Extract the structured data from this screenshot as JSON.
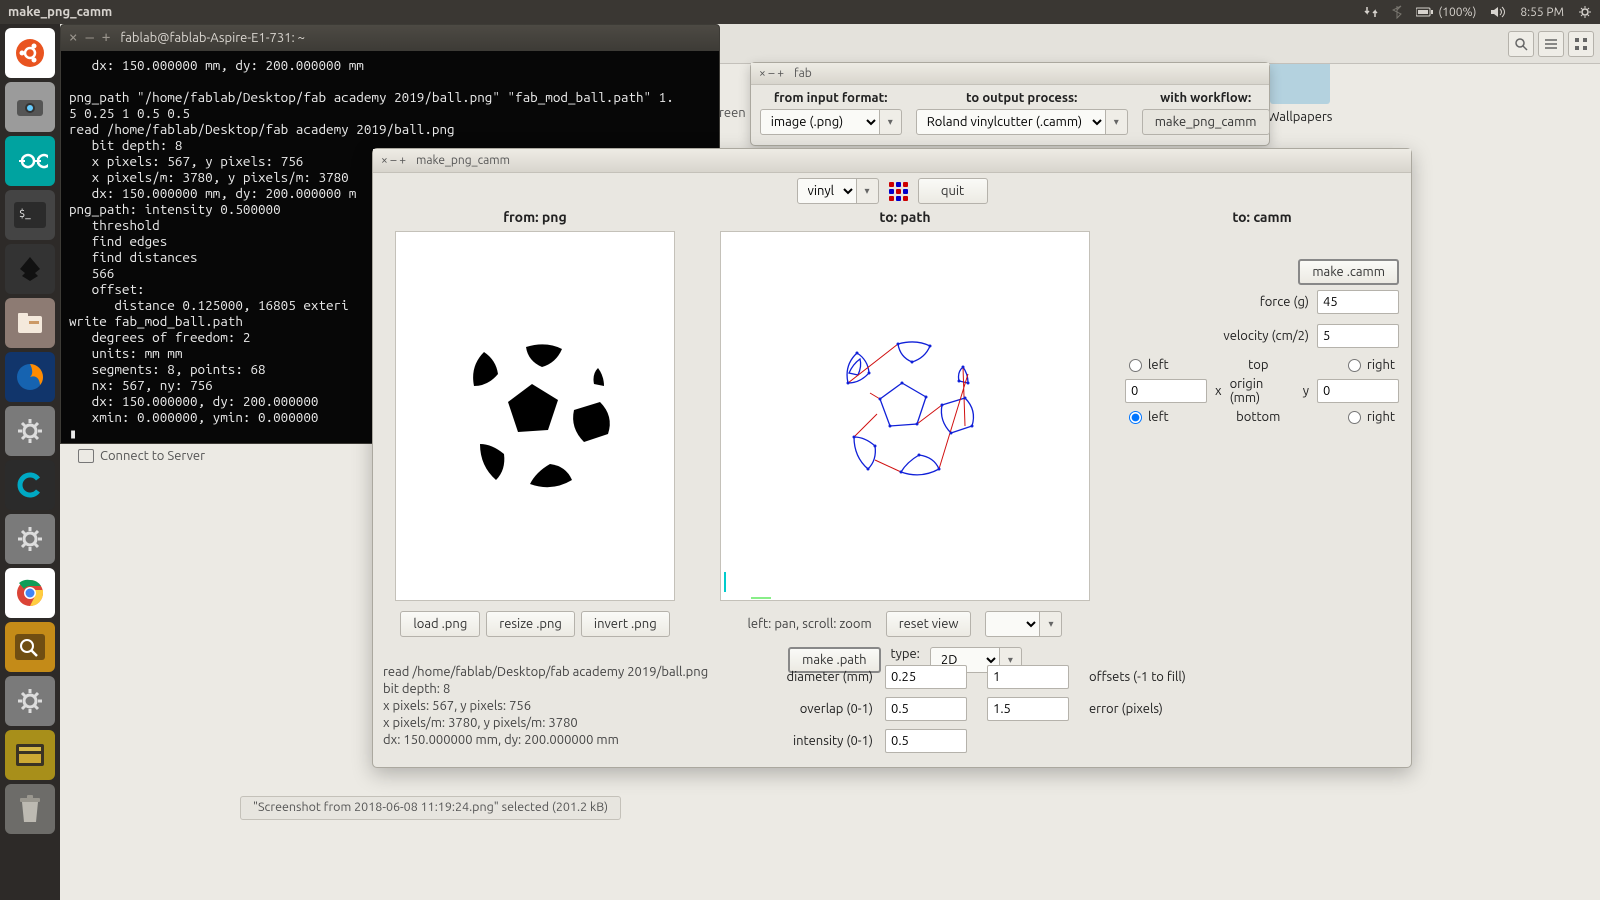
{
  "menubar": {
    "app_title": "make_png_camm",
    "battery": "(100%)",
    "time": "8:55 PM"
  },
  "desktop": {
    "folder_label": "Wallpapers"
  },
  "nautilus_status": "\"Screenshot from 2018-06-08 11:19:24.png\" selected  (201.2 kB)",
  "connect_to_server": "Connect to Server",
  "terminal": {
    "title": "fablab@fablab-Aspire-E1-731: ~",
    "text": "   dx: 150.000000 mm, dy: 200.000000 mm\n\npng_path \"/home/fablab/Desktop/fab academy 2019/ball.png\" \"fab_mod_ball.path\" 1.\n5 0.25 1 0.5 0.5\nread /home/fablab/Desktop/fab academy 2019/ball.png\n   bit depth: 8\n   x pixels: 567, y pixels: 756\n   x pixels/m: 3780, y pixels/m: 3780\n   dx: 150.000000 mm, dy: 200.000000 m\npng_path: intensity 0.500000\n   threshold\n   find edges\n   find distances\n   566\n   offset:\n      distance 0.125000, 16805 exteri\nwrite fab_mod_ball.path\n   degrees of freedom: 2\n   units: mm mm\n   segments: 8, points: 68\n   nx: 567, ny: 756\n   dx: 150.000000, dy: 200.000000\n   xmin: 0.000000, ymin: 0.000000\n▮"
  },
  "fab": {
    "title": "fab",
    "from_label": "from input format:",
    "to_label": "to output process:",
    "wf_label": "with workflow:",
    "from_value": "image (.png)",
    "to_value": "Roland vinylcutter (.camm)",
    "wf_value": "make_png_camm",
    "screen_frag": "reen"
  },
  "mpc": {
    "title": "make_png_camm",
    "vinyl": "vinyl",
    "quit": "quit",
    "hdr_from": "from: png",
    "hdr_path": "to: path",
    "hdr_camm": "to: camm",
    "load": "load .png",
    "resize": "resize .png",
    "invert": "invert .png",
    "pan_hint": "left: pan, scroll: zoom",
    "reset_view": "reset view",
    "make_path": "make .path",
    "type_lbl": "type:",
    "type_val": "2D",
    "diam_lbl": "diameter (mm)",
    "diam_val": "0.25",
    "offsets_val": "1",
    "offsets_lbl": "offsets (-1 to fill)",
    "overlap_lbl": "overlap (0-1)",
    "overlap_val": "0.5",
    "error_val": "1.5",
    "error_lbl": "error (pixels)",
    "intensity_lbl": "intensity (0-1)",
    "intensity_val": "0.5",
    "make_camm": "make .camm",
    "force_lbl": "force (g)",
    "force_val": "45",
    "vel_lbl": "velocity (cm/2)",
    "vel_val": "5",
    "left": "left",
    "right": "right",
    "top": "top",
    "bottom": "bottom",
    "x_lbl": "x",
    "y_lbl": "y",
    "origin_lbl": "origin (mm)",
    "ox": "0",
    "oy": "0",
    "info1": "read /home/fablab/Desktop/fab academy 2019/ball.png",
    "info2": "bit depth: 8",
    "info3": "x pixels: 567, y pixels: 756",
    "info4": "x pixels/m: 3780, y pixels/m: 3780",
    "info5": "dx: 150.000000 mm, dy: 200.000000 mm"
  }
}
